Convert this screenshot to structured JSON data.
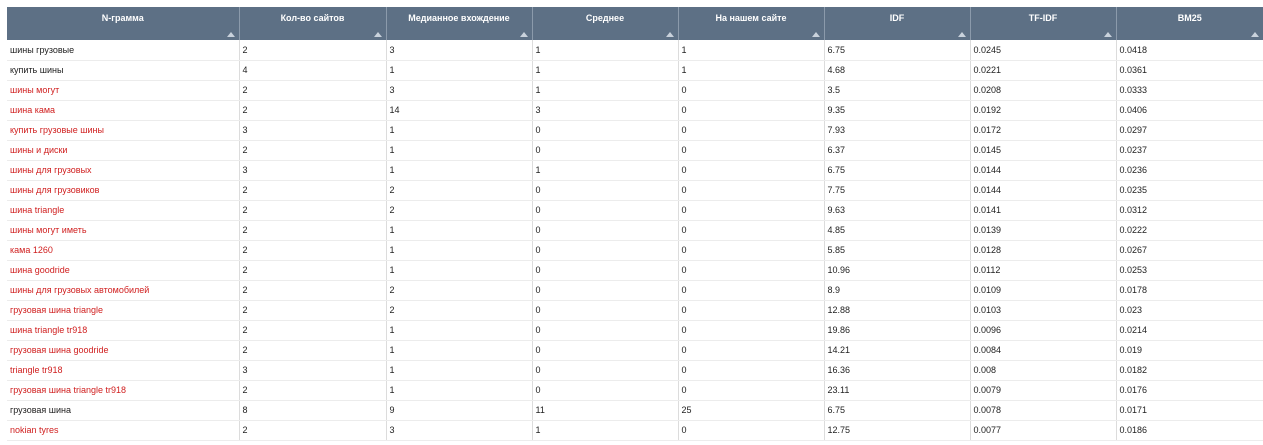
{
  "colors": {
    "header_bg": "#5d7085",
    "header_text": "#ffffff",
    "link_text": "#d01f1f",
    "plain_text": "#222222"
  },
  "table": {
    "columns": [
      {
        "label": "N-грамма",
        "sort_icon": "sort-asc-icon"
      },
      {
        "label": "Кол-во сайтов",
        "sort_icon": "sort-asc-icon"
      },
      {
        "label": "Медианное вхождение",
        "sort_icon": "sort-asc-icon"
      },
      {
        "label": "Среднее",
        "sort_icon": "sort-asc-icon"
      },
      {
        "label": "На нашем сайте",
        "sort_icon": "sort-asc-icon"
      },
      {
        "label": "IDF",
        "sort_icon": "sort-asc-icon"
      },
      {
        "label": "TF-IDF",
        "sort_icon": "sort-asc-icon"
      },
      {
        "label": "BM25",
        "sort_icon": "sort-asc-icon"
      }
    ],
    "rows": [
      {
        "ngram": "шины грузовые",
        "link": false,
        "sites": "2",
        "median": "3",
        "avg": "1",
        "ours": "1",
        "idf": "6.75",
        "tfidf": "0.0245",
        "bm25": "0.0418"
      },
      {
        "ngram": "купить шины",
        "link": false,
        "sites": "4",
        "median": "1",
        "avg": "1",
        "ours": "1",
        "idf": "4.68",
        "tfidf": "0.0221",
        "bm25": "0.0361"
      },
      {
        "ngram": "шины могут",
        "link": true,
        "sites": "2",
        "median": "3",
        "avg": "1",
        "ours": "0",
        "idf": "3.5",
        "tfidf": "0.0208",
        "bm25": "0.0333"
      },
      {
        "ngram": "шина кама",
        "link": true,
        "sites": "2",
        "median": "14",
        "avg": "3",
        "ours": "0",
        "idf": "9.35",
        "tfidf": "0.0192",
        "bm25": "0.0406"
      },
      {
        "ngram": "купить грузовые шины",
        "link": true,
        "sites": "3",
        "median": "1",
        "avg": "0",
        "ours": "0",
        "idf": "7.93",
        "tfidf": "0.0172",
        "bm25": "0.0297"
      },
      {
        "ngram": "шины и диски",
        "link": true,
        "sites": "2",
        "median": "1",
        "avg": "0",
        "ours": "0",
        "idf": "6.37",
        "tfidf": "0.0145",
        "bm25": "0.0237"
      },
      {
        "ngram": "шины для грузовых",
        "link": true,
        "sites": "3",
        "median": "1",
        "avg": "1",
        "ours": "0",
        "idf": "6.75",
        "tfidf": "0.0144",
        "bm25": "0.0236"
      },
      {
        "ngram": "шины для грузовиков",
        "link": true,
        "sites": "2",
        "median": "2",
        "avg": "0",
        "ours": "0",
        "idf": "7.75",
        "tfidf": "0.0144",
        "bm25": "0.0235"
      },
      {
        "ngram": "шина triangle",
        "link": true,
        "sites": "2",
        "median": "2",
        "avg": "0",
        "ours": "0",
        "idf": "9.63",
        "tfidf": "0.0141",
        "bm25": "0.0312"
      },
      {
        "ngram": "шины могут иметь",
        "link": true,
        "sites": "2",
        "median": "1",
        "avg": "0",
        "ours": "0",
        "idf": "4.85",
        "tfidf": "0.0139",
        "bm25": "0.0222"
      },
      {
        "ngram": "кама 1260",
        "link": true,
        "sites": "2",
        "median": "1",
        "avg": "0",
        "ours": "0",
        "idf": "5.85",
        "tfidf": "0.0128",
        "bm25": "0.0267"
      },
      {
        "ngram": "шина goodride",
        "link": true,
        "sites": "2",
        "median": "1",
        "avg": "0",
        "ours": "0",
        "idf": "10.96",
        "tfidf": "0.0112",
        "bm25": "0.0253"
      },
      {
        "ngram": "шины для грузовых автомобилей",
        "link": true,
        "sites": "2",
        "median": "2",
        "avg": "0",
        "ours": "0",
        "idf": "8.9",
        "tfidf": "0.0109",
        "bm25": "0.0178"
      },
      {
        "ngram": "грузовая шина triangle",
        "link": true,
        "sites": "2",
        "median": "2",
        "avg": "0",
        "ours": "0",
        "idf": "12.88",
        "tfidf": "0.0103",
        "bm25": "0.023"
      },
      {
        "ngram": "шина triangle tr918",
        "link": true,
        "sites": "2",
        "median": "1",
        "avg": "0",
        "ours": "0",
        "idf": "19.86",
        "tfidf": "0.0096",
        "bm25": "0.0214"
      },
      {
        "ngram": "грузовая шина goodride",
        "link": true,
        "sites": "2",
        "median": "1",
        "avg": "0",
        "ours": "0",
        "idf": "14.21",
        "tfidf": "0.0084",
        "bm25": "0.019"
      },
      {
        "ngram": "triangle tr918",
        "link": true,
        "sites": "3",
        "median": "1",
        "avg": "0",
        "ours": "0",
        "idf": "16.36",
        "tfidf": "0.008",
        "bm25": "0.0182"
      },
      {
        "ngram": "грузовая шина triangle tr918",
        "link": true,
        "sites": "2",
        "median": "1",
        "avg": "0",
        "ours": "0",
        "idf": "23.11",
        "tfidf": "0.0079",
        "bm25": "0.0176"
      },
      {
        "ngram": "грузовая шина",
        "link": false,
        "sites": "8",
        "median": "9",
        "avg": "11",
        "ours": "25",
        "idf": "6.75",
        "tfidf": "0.0078",
        "bm25": "0.0171"
      },
      {
        "ngram": "nokian tyres",
        "link": true,
        "sites": "2",
        "median": "3",
        "avg": "1",
        "ours": "0",
        "idf": "12.75",
        "tfidf": "0.0077",
        "bm25": "0.0186"
      }
    ]
  }
}
